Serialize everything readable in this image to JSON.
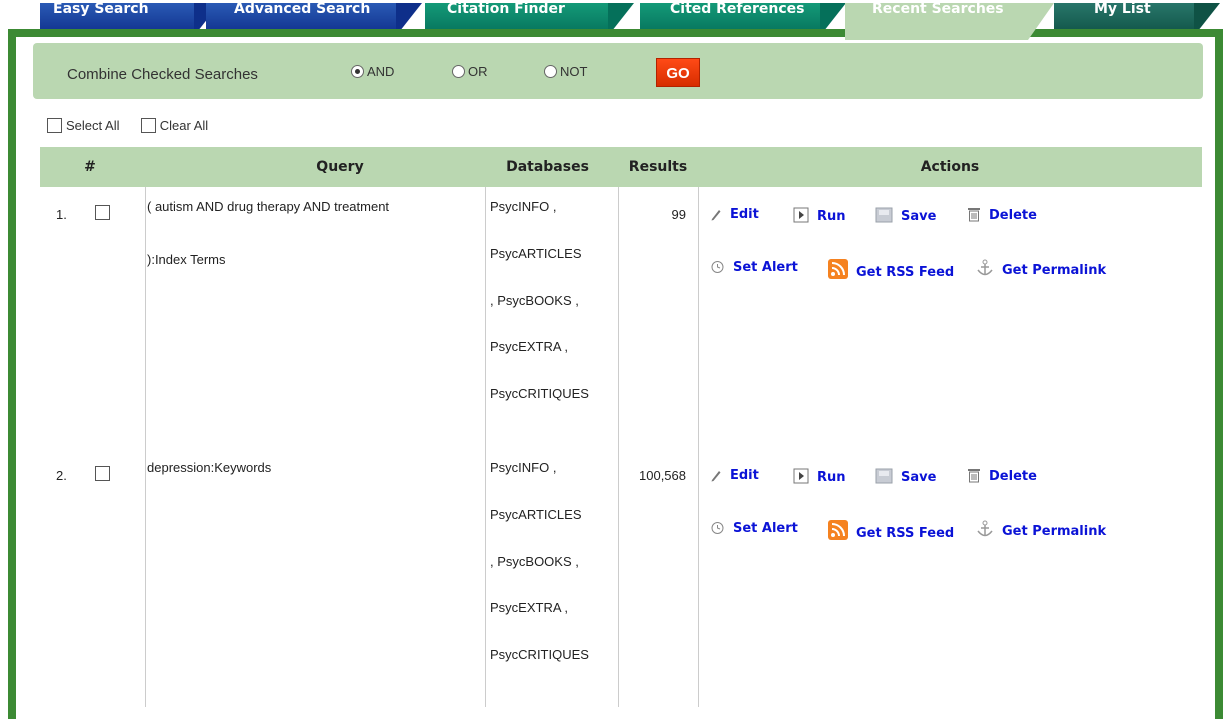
{
  "tabs": [
    {
      "label": "Easy Search"
    },
    {
      "label": "Advanced Search"
    },
    {
      "label": "Citation Finder"
    },
    {
      "label": "Cited References"
    },
    {
      "label": "Recent Searches"
    },
    {
      "label": "My List"
    }
  ],
  "combine": {
    "label": "Combine Checked Searches",
    "options": [
      "AND",
      "OR",
      "NOT"
    ],
    "selected": "AND",
    "go_label": "GO"
  },
  "select_all_label": "Select All",
  "clear_all_label": "Clear All",
  "table": {
    "headers": {
      "num": "#",
      "query": "Query",
      "databases": "Databases",
      "results": "Results",
      "actions": "Actions"
    },
    "rows": [
      {
        "num": "1.",
        "query_line1": "( autism AND drug therapy AND treatment",
        "query_line2": "):Index Terms",
        "databases": [
          "PsycINFO ,",
          "PsycARTICLES",
          ", PsycBOOKS ,",
          "PsycEXTRA ,",
          "PsycCRITIQUES"
        ],
        "results": "99"
      },
      {
        "num": "2.",
        "query_line1": "depression:Keywords",
        "query_line2": "",
        "databases": [
          "PsycINFO ,",
          "PsycARTICLES",
          ", PsycBOOKS ,",
          "PsycEXTRA ,",
          "PsycCRITIQUES"
        ],
        "results": "100,568"
      }
    ]
  },
  "actions": {
    "edit": "Edit",
    "run": "Run",
    "save": "Save",
    "delete": "Delete",
    "set_alert": "Set Alert",
    "rss": "Get RSS Feed",
    "permalink": "Get Permalink"
  },
  "colors": {
    "tab_blue": "#0e2f8a",
    "tab_teal": "#05705a",
    "panel_border": "#3c8a34",
    "header_bg": "#bad7b1",
    "go_button": "#e03400",
    "action_link": "#0b13d6"
  }
}
